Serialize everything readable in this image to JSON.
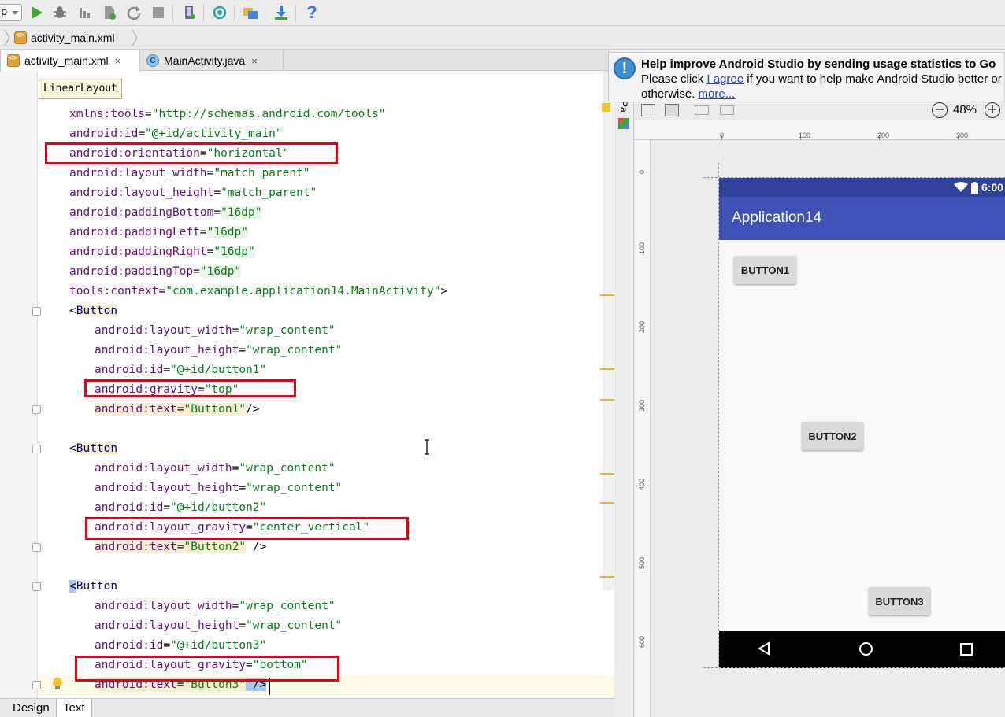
{
  "toolbar": {
    "config_combo": "p",
    "icons": [
      "run-icon",
      "debug-icon",
      "attach-debugger-icon",
      "apply-changes-icon",
      "rerun-icon",
      "stop-icon",
      "avd-manager-icon",
      "sync-gradle-icon",
      "project-structure-icon",
      "sdk-manager-icon",
      "help-icon"
    ],
    "help_glyph": "?"
  },
  "breadcrumb": {
    "file": "activity_main.xml"
  },
  "editor_tabs": [
    {
      "label": "activity_main.xml",
      "close": "×"
    },
    {
      "label": "MainActivity.java",
      "close": "×",
      "icon_letter": "C"
    }
  ],
  "tooltip": "LinearLayout",
  "code": [
    {
      "attr": "xmlns:tools",
      "val": "\"http://schemas.android.com/tools\""
    },
    {
      "attr": "android:id",
      "val": "\"@+id/activity_main\""
    },
    {
      "attr": "android:orientation",
      "val": "\"horizontal\""
    },
    {
      "attr": "android:layout_width",
      "val": "\"match_parent\""
    },
    {
      "attr": "android:layout_height",
      "val": "\"match_parent\""
    },
    {
      "attr": "android:paddingBottom",
      "val": "\"16dp\""
    },
    {
      "attr": "android:paddingLeft",
      "val": "\"16dp\""
    },
    {
      "attr": "android:paddingRight",
      "val": "\"16dp\""
    },
    {
      "attr": "android:paddingTop",
      "val": "\"16dp\""
    },
    {
      "attr": "tools:context",
      "val": "\"com.example.application14.MainActivity\"",
      "tail": ">"
    },
    {
      "tag": "Button",
      "open": "<"
    },
    {
      "attr": "android:layout_width",
      "val": "\"wrap_content\""
    },
    {
      "attr": "android:layout_height",
      "val": "\"wrap_content\""
    },
    {
      "attr": "android:id",
      "val": "\"@+id/button1\""
    },
    {
      "attr": "android:gravity",
      "val": "\"top\""
    },
    {
      "attr": "android:text",
      "val": "\"Button1\"",
      "tail": "/>"
    },
    {
      "tag": "Button",
      "open": "<"
    },
    {
      "attr": "android:layout_width",
      "val": "\"wrap_content\""
    },
    {
      "attr": "android:layout_height",
      "val": "\"wrap_content\""
    },
    {
      "attr": "android:id",
      "val": "\"@+id/button2\""
    },
    {
      "attr": "android:layout_gravity",
      "val": "\"center_vertical\""
    },
    {
      "attr": "android:text",
      "val": "\"Button2\"",
      "tail": " />"
    },
    {
      "tag": "Button",
      "open": "<"
    },
    {
      "attr": "android:layout_width",
      "val": "\"wrap_content\""
    },
    {
      "attr": "android:layout_height",
      "val": "\"wrap_content\""
    },
    {
      "attr": "android:id",
      "val": "\"@+id/button3\""
    },
    {
      "attr": "android:layout_gravity",
      "val": "\"bottom\""
    },
    {
      "attr": "android:text",
      "val": "\"Button3\"",
      "tail": " />"
    }
  ],
  "bottom_tabs": [
    "Design",
    "Text"
  ],
  "notification": {
    "title": "Help improve Android Studio by sending usage statistics to Go",
    "line2_pre": "Please click ",
    "agree_link": "I agree",
    "line2_post": " if you want to help make Android Studio better or ",
    "line2_link": "I",
    "line3_pre": "otherwise. ",
    "more_link": "more..."
  },
  "palette_label": "Pa",
  "zoom": {
    "out": "−",
    "level": "48%",
    "in": "+"
  },
  "ruler": {
    "h": [
      "0",
      "100",
      "200",
      "300"
    ],
    "v": [
      "0",
      "100",
      "200",
      "300",
      "400",
      "500",
      "600"
    ]
  },
  "device": {
    "clock": "6:00",
    "app_title": "Application14",
    "buttons": [
      "BUTTON1",
      "BUTTON2",
      "BUTTON3"
    ],
    "status_bar_color": "#30419b",
    "app_bar_color": "#3f51b5"
  },
  "colors": {
    "attr": "#660e7a",
    "value": "#067d17",
    "tag": "#000080",
    "annotation_red": "#e60012"
  }
}
